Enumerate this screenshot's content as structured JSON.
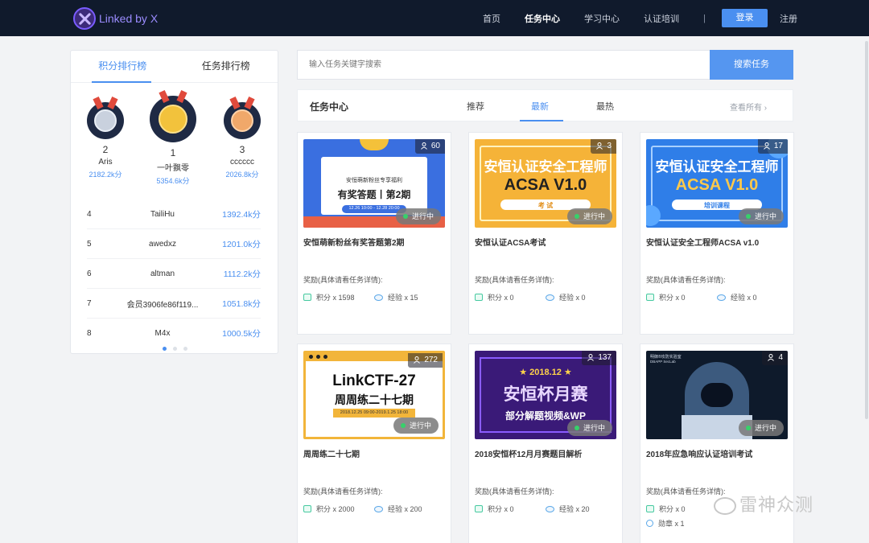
{
  "nav": {
    "logo_text": "Linked by X",
    "items": [
      "首页",
      "任务中心",
      "学习中心",
      "认证培训"
    ],
    "separator": "|",
    "login": "登录",
    "register": "注册"
  },
  "leaderboard": {
    "tabs": [
      "积分排行榜",
      "任务排行榜"
    ],
    "podium": [
      {
        "rank": "2",
        "name": "Aris",
        "points": "2182.2k分"
      },
      {
        "rank": "1",
        "name": "一叶飘零",
        "points": "5354.6k分"
      },
      {
        "rank": "3",
        "name": "cccccc",
        "points": "2026.8k分"
      }
    ],
    "rows": [
      {
        "rank": "4",
        "name": "TailiHu",
        "points": "1392.4k分"
      },
      {
        "rank": "5",
        "name": "awedxz",
        "points": "1201.0k分"
      },
      {
        "rank": "6",
        "name": "altman",
        "points": "1112.2k分"
      },
      {
        "rank": "7",
        "name": "会员3906fe86f119...",
        "points": "1051.8k分"
      },
      {
        "rank": "8",
        "name": "M4x",
        "points": "1000.5k分"
      }
    ]
  },
  "search": {
    "placeholder": "输入任务关键字搜索",
    "button": "搜索任务"
  },
  "tasks": {
    "title": "任务中心",
    "tabs": [
      "推荐",
      "最新",
      "最热"
    ],
    "view_all": "查看所有 ›",
    "reward_label": "奖励(具体请看任务详情):",
    "status": "进行中",
    "cards": [
      {
        "count": "60",
        "title": "安恒萌新粉丝有奖答题第2期",
        "points": "积分 x 1598",
        "exp": "经验 x 15",
        "thumb": {
          "line1": "安恒萌新粉丝专享福利",
          "line2": "有奖答题丨第2期",
          "line3": "12.26 10:00 - 12.28 20:00"
        }
      },
      {
        "count": "3",
        "title": "安恒认证ACSA考试",
        "points": "积分 x 0",
        "exp": "经验 x 0",
        "thumb": {
          "line1": "安恒认证安全工程师",
          "line2": "ACSA V1.0",
          "line3": "考 试"
        }
      },
      {
        "count": "17",
        "title": "安恒认证安全工程师ACSA v1.0",
        "points": "积分 x 0",
        "exp": "经验 x 0",
        "thumb": {
          "line1": "安恒认证安全工程师",
          "line2": "ACSA V1.0",
          "line3": "培训课程"
        }
      },
      {
        "count": "272",
        "title": "周周练二十七期",
        "points": "积分 x 2000",
        "exp": "经验 x 200",
        "thumb": {
          "line1": "LinkCTF-27",
          "line2": "周周练二十七期",
          "line3": "2018.12.25 09:00-2019.1.25 18:00"
        }
      },
      {
        "count": "137",
        "title": "2018安恒杯12月月赛题目解析",
        "points": "积分 x 0",
        "exp": "经验 x 20",
        "thumb": {
          "line1": "★ 2018.12 ★",
          "line2": "安恒杯月赛",
          "line3": "部分解题视频&WP"
        }
      },
      {
        "count": "4",
        "title": "2018年应急响应认证培训考试",
        "points": "积分 x 0",
        "exp": "",
        "badge": "勋章 x 1",
        "thumb": {
          "line1": "明御®攻防实验室",
          "line2": "DBAPP SecLab",
          "line3": ""
        }
      }
    ]
  },
  "watermark": "雷神众测",
  "colors": {
    "nav_bg": "#101a2c",
    "accent": "#4a8ff0",
    "status_green": "#37d16a"
  }
}
